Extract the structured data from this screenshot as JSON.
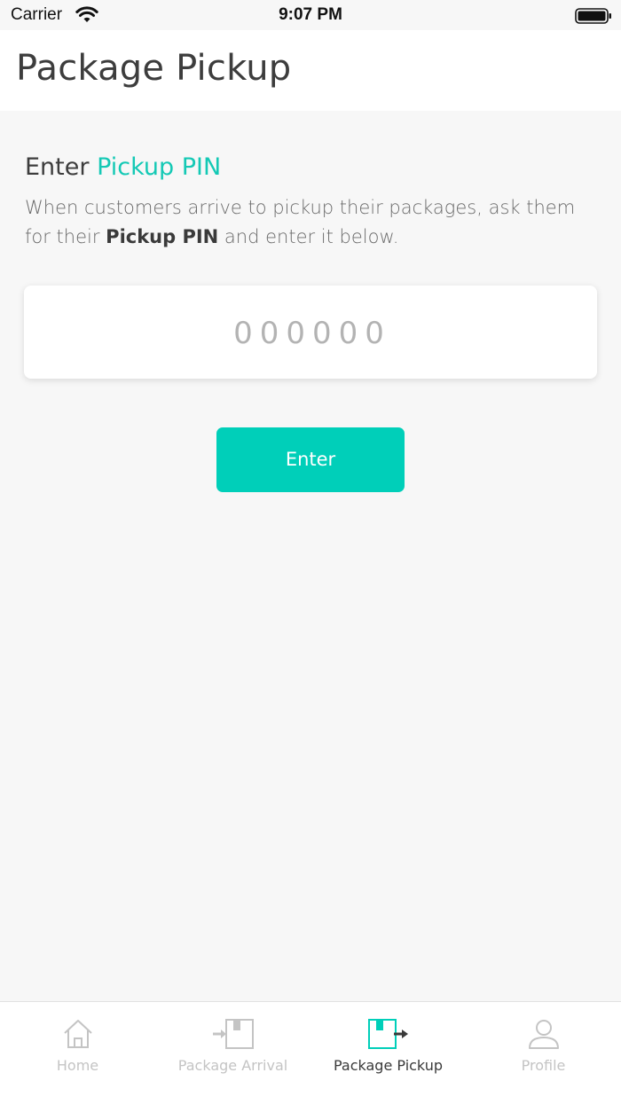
{
  "status_bar": {
    "carrier": "Carrier",
    "time": "9:07 PM"
  },
  "header": {
    "title": "Package Pickup"
  },
  "main": {
    "heading_prefix": "Enter",
    "heading_accent": "Pickup PIN",
    "instructions_part1": "When customers arrive to pickup their packages, ask them for their ",
    "instructions_bold": "Pickup PIN",
    "instructions_part2": " and enter it below.",
    "pin_placeholder": "000000",
    "pin_value": "",
    "enter_label": "Enter"
  },
  "tab_bar": {
    "items": [
      {
        "label": "Home",
        "icon": "home-icon",
        "active": false
      },
      {
        "label": "Package Arrival",
        "icon": "package-arrival-icon",
        "active": false
      },
      {
        "label": "Package Pickup",
        "icon": "package-pickup-icon",
        "active": true
      },
      {
        "label": "Profile",
        "icon": "profile-icon",
        "active": false
      }
    ]
  },
  "colors": {
    "accent": "#00cfb9",
    "background": "#f7f7f7",
    "title_text": "#3d3d3d",
    "inactive_tab": "#c4c4c4"
  }
}
